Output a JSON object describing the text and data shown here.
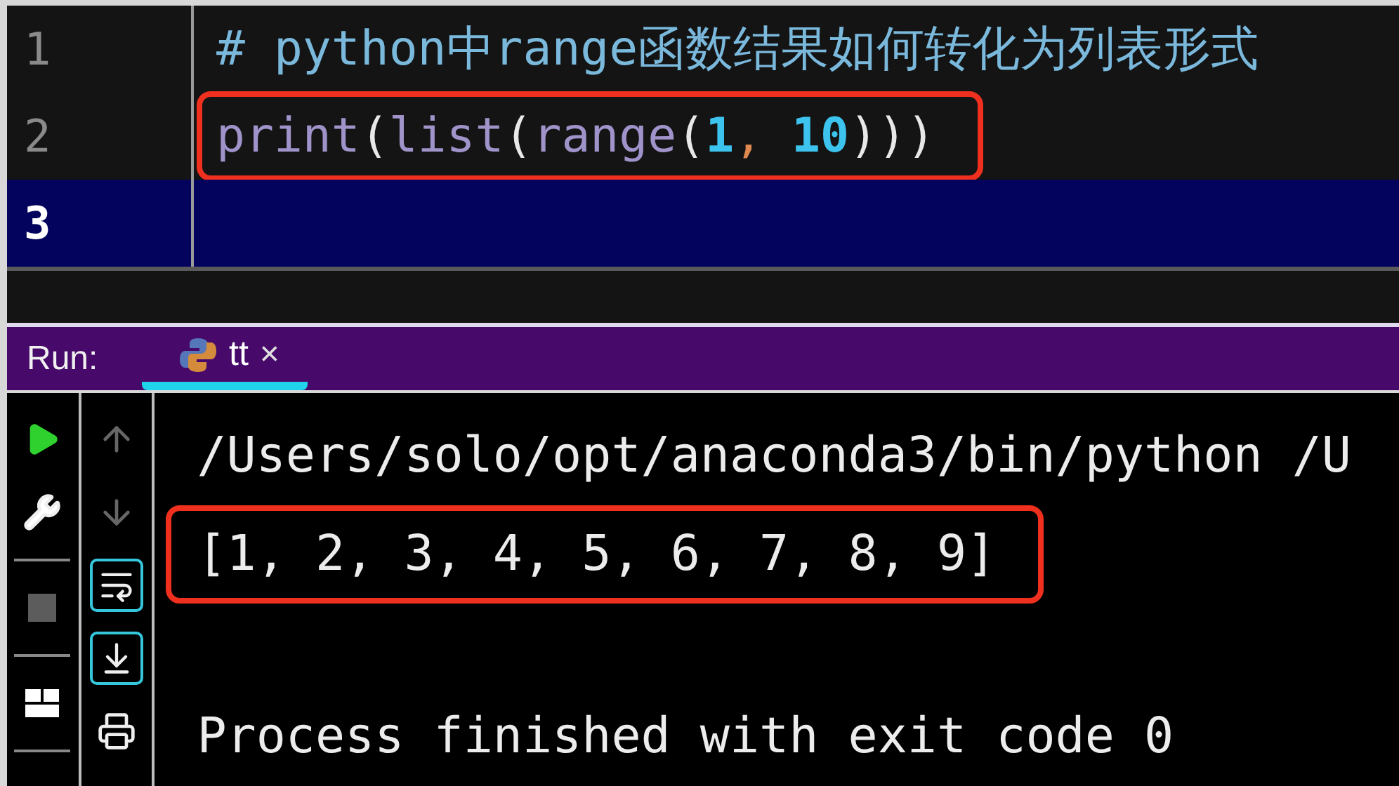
{
  "editor": {
    "lines": [
      {
        "number": "1",
        "current": false,
        "highlighted": false,
        "tokens": [
          {
            "kind": "comment",
            "text": "# python中range函数结果如何转化为列表形式"
          }
        ]
      },
      {
        "number": "2",
        "current": false,
        "highlighted": true,
        "tokens": [
          {
            "kind": "name",
            "text": "print"
          },
          {
            "kind": "punct",
            "text": "("
          },
          {
            "kind": "name",
            "text": "list"
          },
          {
            "kind": "punct",
            "text": "("
          },
          {
            "kind": "name",
            "text": "range"
          },
          {
            "kind": "punct",
            "text": "("
          },
          {
            "kind": "number",
            "text": "1"
          },
          {
            "kind": "comma",
            "text": ", "
          },
          {
            "kind": "number",
            "text": "10"
          },
          {
            "kind": "punct",
            "text": ")))"
          }
        ]
      },
      {
        "number": "3",
        "current": true,
        "highlighted": false
      }
    ]
  },
  "run_panel": {
    "label": "Run:",
    "tabs": [
      {
        "label": "tt",
        "close": "×",
        "selected": true
      }
    ]
  },
  "console": {
    "lines": [
      {
        "text": "/Users/solo/opt/anaconda3/bin/python /U",
        "highlighted": false
      },
      {
        "text": "[1, 2, 3, 4, 5, 6, 7, 8, 9]",
        "highlighted": true
      },
      {
        "text": "Process finished with exit code 0",
        "highlighted": false
      }
    ]
  }
}
